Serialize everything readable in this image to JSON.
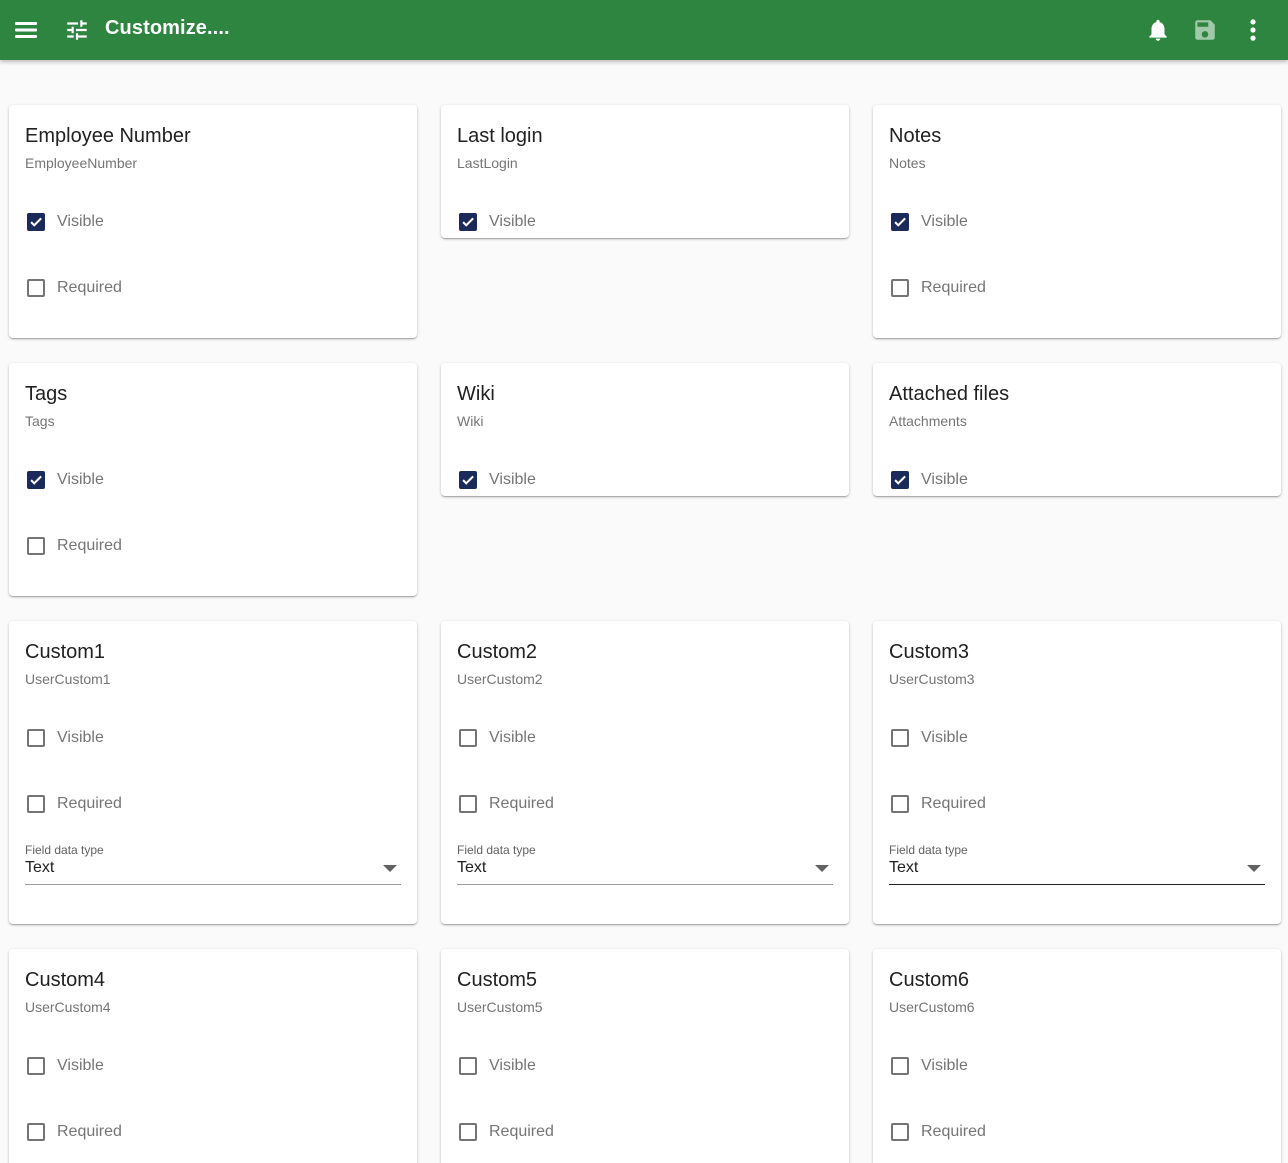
{
  "header": {
    "title": "Customize....",
    "icons": {
      "menu": "menu-icon",
      "customize": "tune-icon",
      "notifications": "bell-icon",
      "save": "save-icon",
      "more": "more-vert-icon"
    },
    "color": "#2e8540"
  },
  "checkbox_color": "#1a2a5a",
  "cards": [
    {
      "title": "Employee Number",
      "field": "EmployeeNumber",
      "visible": true,
      "visible_label": "Visible",
      "required": false,
      "required_label": "Required"
    },
    {
      "title": "Last login",
      "field": "LastLogin",
      "visible": true,
      "visible_label": "Visible"
    },
    {
      "title": "Notes",
      "field": "Notes",
      "visible": true,
      "visible_label": "Visible",
      "required": false,
      "required_label": "Required"
    },
    {
      "title": "Tags",
      "field": "Tags",
      "visible": true,
      "visible_label": "Visible",
      "required": false,
      "required_label": "Required"
    },
    {
      "title": "Wiki",
      "field": "Wiki",
      "visible": true,
      "visible_label": "Visible"
    },
    {
      "title": "Attached files",
      "field": "Attachments",
      "visible": true,
      "visible_label": "Visible"
    },
    {
      "title": "Custom1",
      "field": "UserCustom1",
      "visible": false,
      "visible_label": "Visible",
      "required": false,
      "required_label": "Required",
      "type_label": "Field data type",
      "type_value": "Text"
    },
    {
      "title": "Custom2",
      "field": "UserCustom2",
      "visible": false,
      "visible_label": "Visible",
      "required": false,
      "required_label": "Required",
      "type_label": "Field data type",
      "type_value": "Text"
    },
    {
      "title": "Custom3",
      "field": "UserCustom3",
      "visible": false,
      "visible_label": "Visible",
      "required": false,
      "required_label": "Required",
      "type_label": "Field data type",
      "type_value": "Text"
    },
    {
      "title": "Custom4",
      "field": "UserCustom4",
      "visible": false,
      "visible_label": "Visible",
      "required": false,
      "required_label": "Required"
    },
    {
      "title": "Custom5",
      "field": "UserCustom5",
      "visible": false,
      "visible_label": "Visible",
      "required": false,
      "required_label": "Required"
    },
    {
      "title": "Custom6",
      "field": "UserCustom6",
      "visible": false,
      "visible_label": "Visible",
      "required": false,
      "required_label": "Required"
    }
  ]
}
